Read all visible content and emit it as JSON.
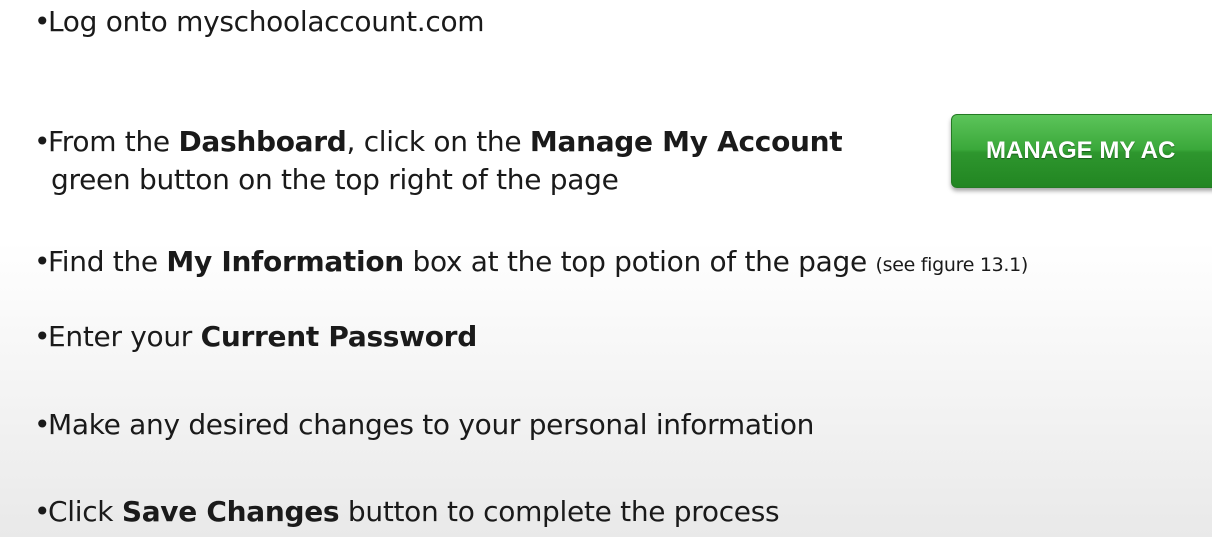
{
  "bullet": "•",
  "steps": {
    "s1": {
      "text": "Log onto myschoolaccount.com"
    },
    "s2": {
      "pre": "From the ",
      "bold1": "Dashboard",
      "mid": ", click on the ",
      "bold2": "Manage My Account",
      "line2": "green button on the top right of the page"
    },
    "s3": {
      "pre": "Find the ",
      "bold": "My Information",
      "post": " box at the top potion of the page ",
      "note": "(see figure 13.1)"
    },
    "s4": {
      "pre": "Enter your ",
      "bold": "Current Password"
    },
    "s5": {
      "text": "Make any desired changes to your personal information"
    },
    "s6": {
      "pre": "Click ",
      "bold": "Save Changes",
      "post": " button to complete the process"
    }
  },
  "manage_button": {
    "label": "MANAGE MY AC"
  }
}
